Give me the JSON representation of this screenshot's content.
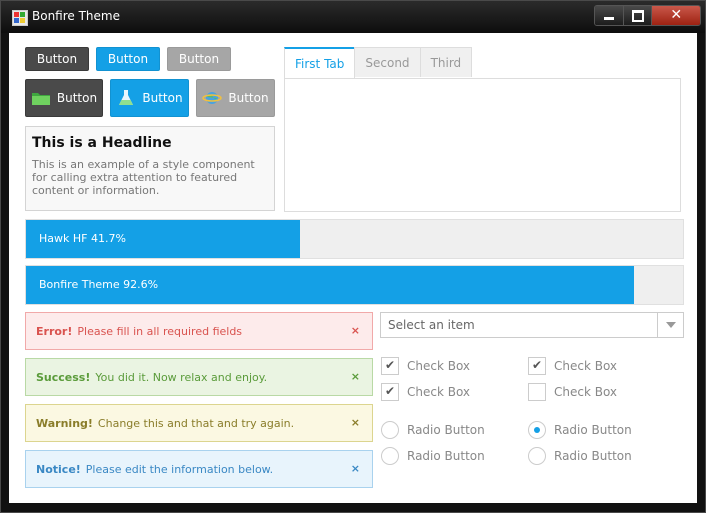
{
  "window": {
    "title": "Bonfire Theme"
  },
  "buttons": {
    "row1": [
      "Button",
      "Button",
      "Button"
    ],
    "row2": [
      "Button",
      "Button",
      "Button"
    ],
    "icons": [
      "folder-icon",
      "flask-icon",
      "planet-icon"
    ]
  },
  "callout": {
    "headline": "This is a Headline",
    "body": "This is an example of a style component for calling extra attention to featured content or information."
  },
  "tabs": [
    {
      "label": "First Tab",
      "active": true
    },
    {
      "label": "Second",
      "active": false
    },
    {
      "label": "Third",
      "active": false
    }
  ],
  "progress": [
    {
      "label": "Hawk HF 41.7%",
      "value": 0.417
    },
    {
      "label": "Bonfire Theme 92.6%",
      "value": 0.926
    }
  ],
  "alerts": {
    "error": {
      "title": "Error!",
      "text": "Please fill in all required fields",
      "close": "×"
    },
    "success": {
      "title": "Success!",
      "text": "You did it. Now relax and enjoy.",
      "close": "×"
    },
    "warning": {
      "title": "Warning!",
      "text": "Change this and that and try again.",
      "close": "×"
    },
    "notice": {
      "title": "Notice!",
      "text": "Please edit the information below.",
      "close": "×"
    }
  },
  "select": {
    "placeholder": "Select an item"
  },
  "checkboxes": [
    {
      "label": "Check Box",
      "checked": true
    },
    {
      "label": "Check Box",
      "checked": true
    },
    {
      "label": "Check Box",
      "checked": true
    },
    {
      "label": "Check Box",
      "checked": false
    }
  ],
  "radios": [
    {
      "label": "Radio Button",
      "selected": false
    },
    {
      "label": "Radio Button",
      "selected": true
    },
    {
      "label": "Radio Button",
      "selected": false
    },
    {
      "label": "Radio Button",
      "selected": false
    }
  ],
  "colors": {
    "accent": "#14a0e6",
    "dark": "#4a4a4a",
    "gray": "#a6a6a6"
  }
}
